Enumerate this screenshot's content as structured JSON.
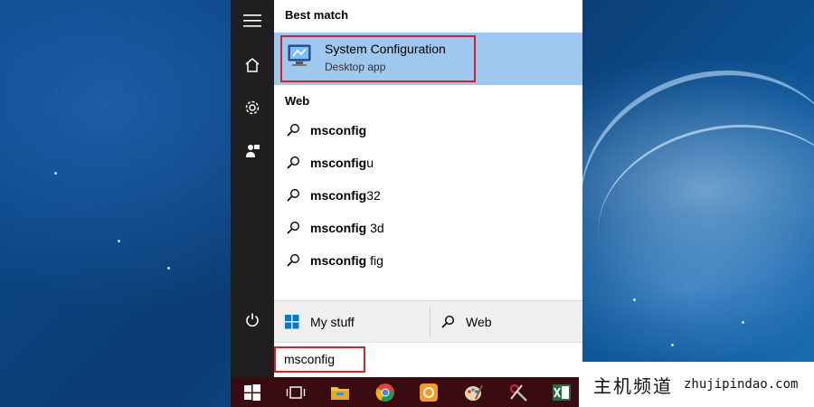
{
  "start_menu": {
    "best_match_header": "Best match",
    "best_match": {
      "title": "System Configuration",
      "subtitle": "Desktop app"
    },
    "web_header": "Web",
    "web_results": [
      {
        "bold": "msconfig",
        "rest": ""
      },
      {
        "bold": "msconfig",
        "rest": "u"
      },
      {
        "bold": "msconfig",
        "rest": "32"
      },
      {
        "bold": "msconfig",
        "rest": " 3d"
      },
      {
        "bold": "msconfig",
        "rest": " fig"
      }
    ],
    "bottom": {
      "my_stuff": "My stuff",
      "web": "Web"
    },
    "search_value": "msconfig"
  },
  "rail_icons": [
    "hamburger-icon",
    "home-icon",
    "settings-icon",
    "feedback-icon",
    "power-icon"
  ],
  "taskbar_icons": [
    "windows-start-icon",
    "task-view-icon",
    "file-explorer-icon",
    "chrome-icon",
    "app-icon",
    "paint-icon",
    "tools-icon",
    "excel-icon"
  ],
  "watermark": {
    "cn": "主机频道",
    "en": "zhujipindao.com"
  },
  "colors": {
    "accent": "#9fc8ef",
    "highlight": "#d6212a",
    "rail": "#1f1f1f",
    "taskbar": "#3a0b10"
  }
}
